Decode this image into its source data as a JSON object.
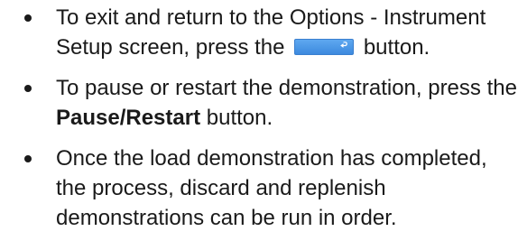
{
  "items": [
    {
      "parts": [
        "To exit and return to the Options - Instrument Setup screen, press the",
        "button."
      ],
      "button_icon": "return-arrow-icon"
    },
    {
      "parts": [
        "To pause or restart the demonstration, press the",
        "Pause/Restart",
        "button."
      ]
    },
    {
      "parts": [
        "Once the load demonstration has completed, the process, discard and replenish demonstrations can be run in order."
      ]
    }
  ],
  "colors": {
    "text": "#1a1a1a",
    "button": "#4a95e6"
  }
}
